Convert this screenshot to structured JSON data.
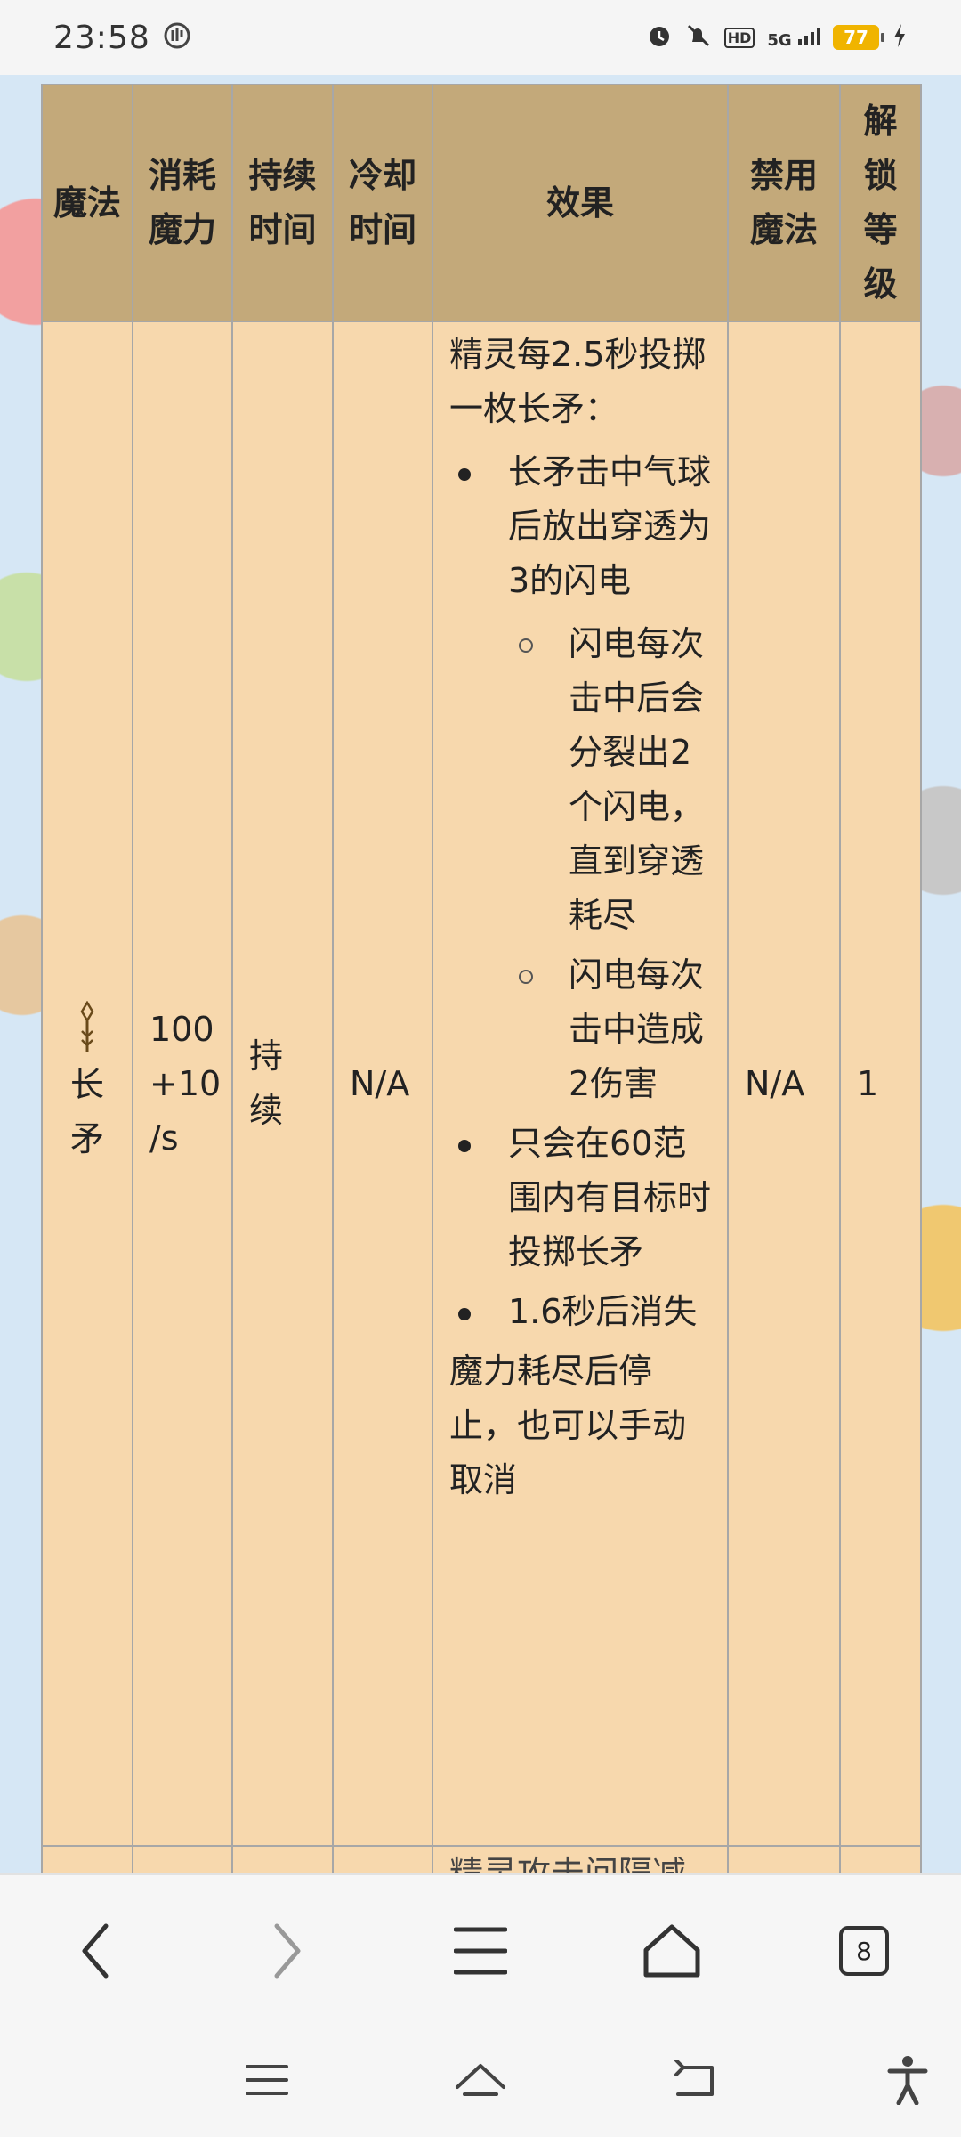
{
  "status_bar": {
    "time": "23:58",
    "network": "5G",
    "hd_label": "HD",
    "battery": "77"
  },
  "table": {
    "headers": [
      "魔法",
      "消耗魔力",
      "持续时间",
      "冷却时间",
      "效果",
      "禁用魔法",
      "解锁等级"
    ],
    "row": {
      "name": "长矛",
      "cost": "100 +10 /s",
      "duration": "持续",
      "cooldown": "N/A",
      "effect_intro": "精灵每2.5秒投掷一枚长矛：",
      "effect_bullets": [
        {
          "text": "长矛击中气球后放出穿透为3的闪电",
          "sub": [
            "闪电每次击中后会分裂出2个闪电，直到穿透耗尽",
            "闪电每次击中造成2伤害"
          ]
        },
        {
          "text": "只会在60范围内有目标时投掷长矛"
        },
        {
          "text": "1.6秒后消失"
        }
      ],
      "effect_outro": "魔力耗尽后停止，也可以手动取消",
      "disabled": "N/A",
      "unlock_level": "1"
    },
    "next_row_partial": "精灵攻击间隔减"
  },
  "toolbar": {
    "tab_count": "8"
  },
  "icons": {
    "back": "chevron-left-icon",
    "forward": "chevron-right-icon",
    "menu": "menu-icon",
    "home": "home-icon",
    "tabs": "tabs-icon",
    "spear": "spear-icon",
    "alarm": "alarm-icon",
    "mute": "mute-icon",
    "accessibility": "accessibility-icon"
  },
  "colors": {
    "header_bg": "#c3a97a",
    "cell_bg": "#f7d8ad",
    "battery": "#f0b400"
  }
}
